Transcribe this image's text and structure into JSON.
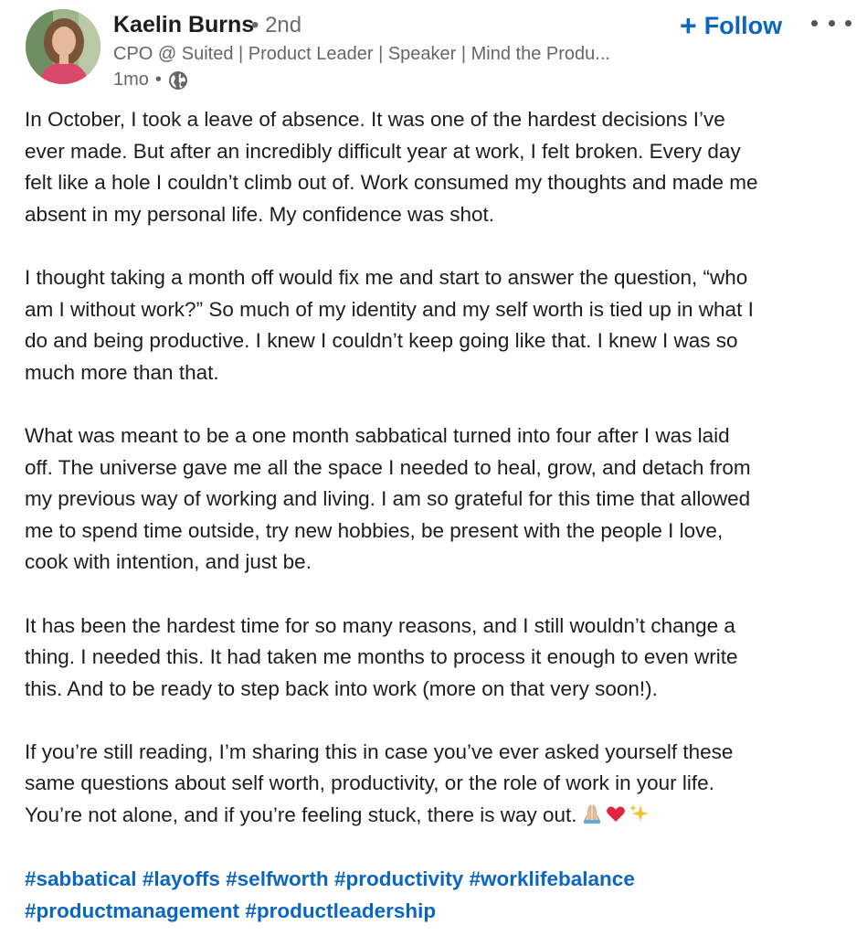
{
  "author": {
    "name": "Kaelin Burns",
    "degree": "• 2nd",
    "headline": "CPO @ Suited | Product Leader | Speaker | Mind the Produ...",
    "time": "1mo",
    "separator": "•",
    "visibility_icon": "globe-icon"
  },
  "actions": {
    "follow_label": "Follow",
    "follow_icon": "plus-icon",
    "more_icon": "ellipsis-icon"
  },
  "post": {
    "paragraphs": [
      {
        "lines": [
          "In October, I took a leave of absence. It was one of the hardest decisions I’ve",
          "ever made. But after an incredibly difficult year at work, I felt broken. Every day",
          "felt like a hole I couldn’t climb out of. Work consumed my thoughts and made me",
          "absent in my personal life. My confidence was shot."
        ]
      },
      {
        "lines": [
          "I thought taking a month off would fix me and start to answer the question, “who",
          "am I without work?” So much of my identity and my self worth is tied up in what I",
          "do and being productive. I knew I couldn’t keep going like that. I knew I was so",
          "much more than that."
        ]
      },
      {
        "lines": [
          "What was meant to be a one month sabbatical turned into four after I was laid",
          "off. The universe gave me all the space I needed to heal, grow, and detach from",
          "my previous way of working and living. I am so grateful for this time that allowed",
          "me to spend time outside, try new hobbies, be present with the people I love,",
          "cook with intention, and just be."
        ]
      },
      {
        "lines": [
          "It has been the hardest time for so many reasons, and I still wouldn’t change a",
          "thing. I needed this. It had taken me months to process it enough to even write",
          "this. And to be ready to step back into work (more on that very soon!)."
        ]
      },
      {
        "lines": [
          "If you’re still reading, I’m sharing this in case you’ve ever asked yourself these",
          "same questions about self worth, productivity, or the role of work in your life.",
          "You’re not alone, and if you’re feeling stuck, there is way out."
        ],
        "emoji": [
          "praying-hands-icon",
          "red-heart-icon",
          "sparkles-icon"
        ]
      }
    ],
    "hashtag_lines": [
      [
        "#sabbatical",
        "#layoffs",
        "#selfworth",
        "#productivity",
        "#worklifebalance"
      ],
      [
        "#productmanagement",
        "#productleadership"
      ]
    ]
  },
  "colors": {
    "link": "#0a66c2",
    "text": "#1d1d1d",
    "muted": "#666666"
  }
}
